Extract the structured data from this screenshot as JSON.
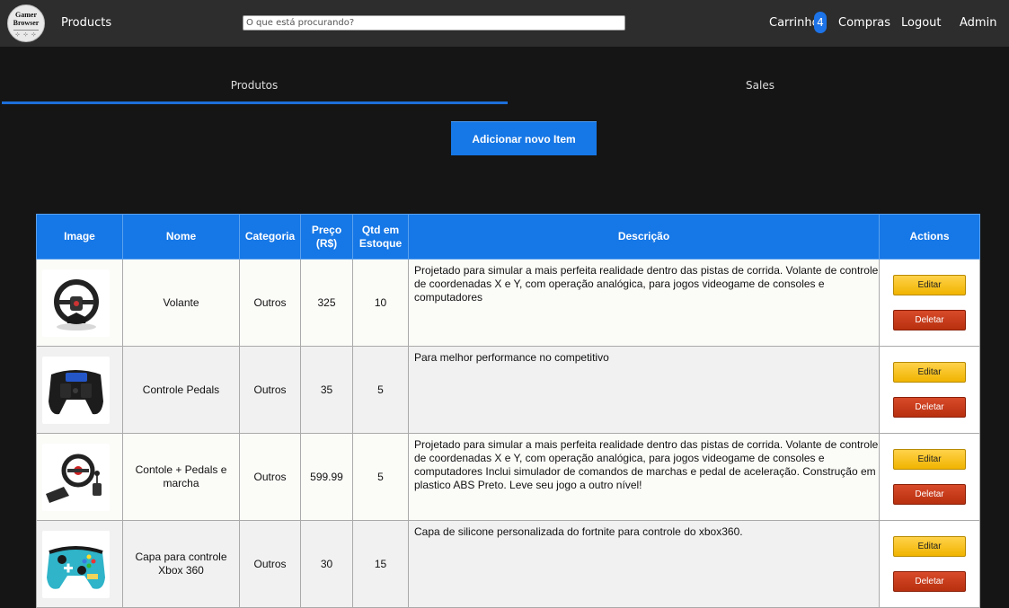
{
  "nav": {
    "logo_line1": "Gamer",
    "logo_line2": "Browser",
    "products_label": "Products",
    "search_placeholder": "O que está procurando?",
    "cart_label": "Carrinho",
    "cart_count": "4",
    "purchases_label": "Compras",
    "logout_label": "Logout",
    "admin_label": "Admin"
  },
  "tabs": {
    "products": "Produtos",
    "sales": "Sales"
  },
  "add_button": "Adicionar novo Item",
  "table": {
    "headers": {
      "image": "Image",
      "name": "Nome",
      "category": "Categoria",
      "price": "Preço (R$)",
      "stock": "Qtd em Estoque",
      "description": "Descrição",
      "actions": "Actions"
    },
    "edit_label": "Editar",
    "delete_label": "Deletar",
    "rows": [
      {
        "name": "Volante",
        "category": "Outros",
        "price": "325",
        "stock": "10",
        "description": "Projetado para simular a mais perfeita realidade dentro das pistas de corrida. Volante de controle de coordenadas X e Y, com operação analógica, para jogos videogame de consoles e computadores"
      },
      {
        "name": "Controle Pedals",
        "category": "Outros",
        "price": "35",
        "stock": "5",
        "description": "Para melhor performance no competitivo"
      },
      {
        "name": "Contole + Pedals e marcha",
        "category": "Outros",
        "price": "599.99",
        "stock": "5",
        "description": "Projetado para simular a mais perfeita realidade dentro das pistas de corrida. Volante de controle de coordenadas X e Y, com operação analógica, para jogos videogame de consoles e computadores Inclui simulador de comandos de marchas e pedal de aceleração. Construção em plastico ABS Preto. Leve seu jogo a outro nível!"
      },
      {
        "name": "Capa para controle Xbox 360",
        "category": "Outros",
        "price": "30",
        "stock": "15",
        "description": "Capa de silicone personalizada do fortnite para controle do xbox360."
      }
    ]
  }
}
